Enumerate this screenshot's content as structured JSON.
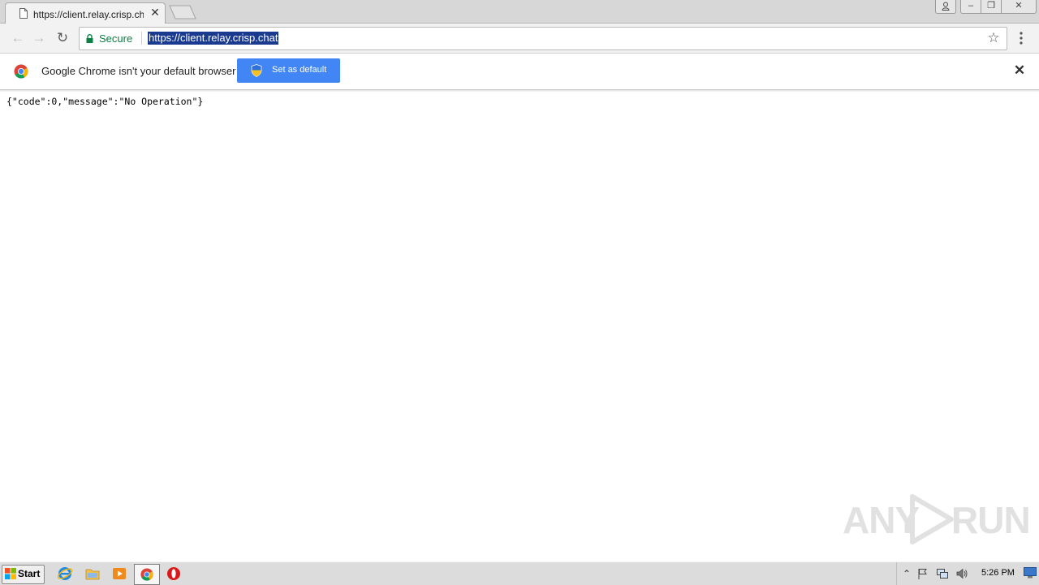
{
  "tab": {
    "title": "https://client.relay.crisp.chat",
    "close_glyph": "✕"
  },
  "window_controls": {
    "user_glyph": " ",
    "minimize_glyph": "–",
    "maximize_glyph": "❐",
    "close_glyph": "✕"
  },
  "toolbar": {
    "back_glyph": "←",
    "forward_glyph": "→",
    "reload_glyph": "↻",
    "secure_label": "Secure",
    "url": "https://client.relay.crisp.chat",
    "star_glyph": "☆"
  },
  "infobar": {
    "message": "Google Chrome isn't your default browser",
    "button_label": "Set as default",
    "close_glyph": "✕"
  },
  "content": {
    "body_text": "{\"code\":0,\"message\":\"No Operation\"}"
  },
  "watermark": {
    "left": "ANY",
    "right": "RUN"
  },
  "taskbar": {
    "start_label": "Start",
    "tray": {
      "chevron_glyph": "⌃",
      "clock": "5:26 PM"
    }
  },
  "icons": {
    "tab": "page-icon",
    "secure": "lock-icon",
    "bookmark": "star-icon",
    "menu": "vertical-dots-icon",
    "infobar": "chrome-logo-icon",
    "button": "uac-shield-icon",
    "taskbar": [
      "windows-logo-icon",
      "internet-explorer-icon",
      "file-explorer-icon",
      "media-player-icon",
      "chrome-icon",
      "opera-icon"
    ],
    "tray": [
      "chevron-up-icon",
      "flag-icon",
      "network-icon",
      "volume-icon",
      "show-desktop-icon"
    ]
  },
  "colors": {
    "secure_green": "#0b8043",
    "url_selection": "#1a3a8f",
    "button_blue": "#4285f4",
    "watermark_gray": "#e1e1e1"
  }
}
